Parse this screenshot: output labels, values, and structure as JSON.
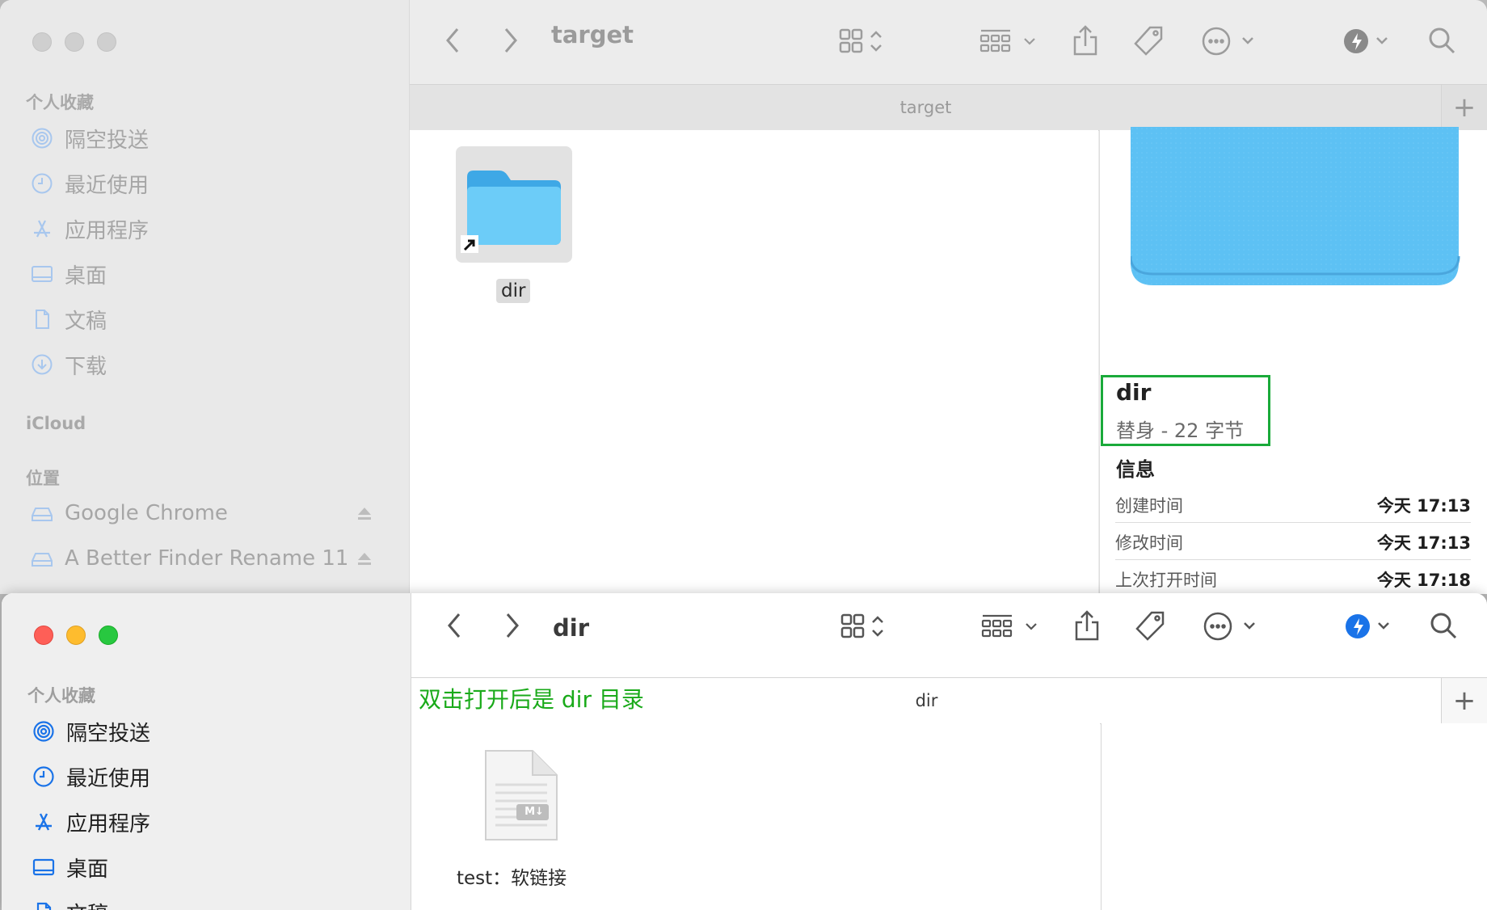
{
  "window_back": {
    "sidebar": {
      "favorites_header": "个人收藏",
      "favorites": [
        {
          "label": "隔空投送",
          "icon": "airdrop-icon"
        },
        {
          "label": "最近使用",
          "icon": "clock-icon"
        },
        {
          "label": "应用程序",
          "icon": "apps-icon"
        },
        {
          "label": "桌面",
          "icon": "desktop-icon"
        },
        {
          "label": "文稿",
          "icon": "document-icon"
        },
        {
          "label": "下载",
          "icon": "download-icon"
        }
      ],
      "icloud_header": "iCloud",
      "locations_header": "位置",
      "locations": [
        {
          "label": "Google Chrome",
          "icon": "drive-icon"
        },
        {
          "label": "A Better Finder Rename 11",
          "icon": "drive-icon"
        }
      ]
    },
    "toolbar": {
      "title": "target"
    },
    "tab": {
      "title": "target",
      "plus": "+"
    },
    "content": {
      "item_name": "dir"
    },
    "preview": {
      "name": "dir",
      "kind": "替身 - 22 字节",
      "info_header": "信息",
      "rows": [
        {
          "key": "创建时间",
          "value": "今天 17:13"
        },
        {
          "key": "修改时间",
          "value": "今天 17:13"
        },
        {
          "key": "上次打开时间",
          "value": "今天 17:18"
        }
      ]
    }
  },
  "window_front": {
    "sidebar": {
      "favorites_header": "个人收藏",
      "favorites": [
        {
          "label": "隔空投送",
          "icon": "airdrop-icon"
        },
        {
          "label": "最近使用",
          "icon": "clock-icon"
        },
        {
          "label": "应用程序",
          "icon": "apps-icon"
        },
        {
          "label": "桌面",
          "icon": "desktop-icon"
        },
        {
          "label": "文稿",
          "icon": "document-icon"
        }
      ]
    },
    "toolbar": {
      "title": "dir"
    },
    "tab": {
      "title": "dir",
      "plus": "+"
    },
    "annotation": "双击打开后是 dir 目录",
    "content": {
      "item_name": "test：软链接",
      "badge": "M↓"
    }
  },
  "colors": {
    "accent": "#1a73e8",
    "folder": "#5fc1f5",
    "annotation_green": "#1aaa1a"
  }
}
